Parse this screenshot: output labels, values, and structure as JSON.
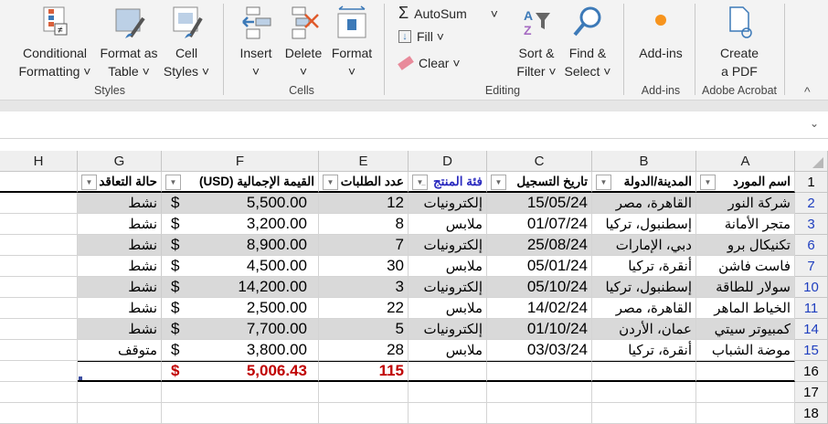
{
  "ribbon": {
    "styles": {
      "conditional": [
        "Conditional",
        "Formatting ˅"
      ],
      "format_table": [
        "Format as",
        "Table ˅"
      ],
      "cell_styles": [
        "Cell",
        "Styles ˅"
      ],
      "label": "Styles"
    },
    "cells": {
      "insert": "Insert",
      "delete": "Delete",
      "format": "Format",
      "label": "Cells"
    },
    "editing": {
      "autosum": "AutoSum",
      "fill": "Fill ˅",
      "clear": "Clear ˅",
      "sort": [
        "Sort &",
        "Filter ˅"
      ],
      "find": [
        "Find &",
        "Select ˅"
      ],
      "label": "Editing"
    },
    "addins": {
      "button": "Add-ins",
      "label": "Add-ins"
    },
    "acrobat": {
      "button": [
        "Create",
        "a PDF"
      ],
      "label": "Adobe Acrobat"
    }
  },
  "sheet": {
    "columns": [
      "H",
      "G",
      "F",
      "E",
      "D",
      "C",
      "B",
      "A"
    ],
    "headers": {
      "A": "اسم المورد",
      "B": "المدينة/الدولة",
      "C": "تاريخ التسجيل",
      "D": "فئة المنتج",
      "E": "عدد الطلبات",
      "F": "(USD) القيمة الإجمالية",
      "G": "حالة التعاقد"
    },
    "rows": [
      {
        "n": "2",
        "A": "شركة النور",
        "B": "القاهرة، مصر",
        "C": "15/05/24",
        "D": "إلكترونيات",
        "E": "12",
        "F": "5,500.00",
        "G": "نشط"
      },
      {
        "n": "3",
        "A": "متجر الأمانة",
        "B": "إسطنبول، تركيا",
        "C": "01/07/24",
        "D": "ملابس",
        "E": "8",
        "F": "3,200.00",
        "G": "نشط"
      },
      {
        "n": "6",
        "A": "تكنيكال برو",
        "B": "دبي، الإمارات",
        "C": "25/08/24",
        "D": "إلكترونيات",
        "E": "7",
        "F": "8,900.00",
        "G": "نشط"
      },
      {
        "n": "7",
        "A": "فاست فاشن",
        "B": "أنقرة، تركيا",
        "C": "05/01/24",
        "D": "ملابس",
        "E": "30",
        "F": "4,500.00",
        "G": "نشط"
      },
      {
        "n": "10",
        "A": "سولار للطاقة",
        "B": "إسطنبول، تركيا",
        "C": "05/10/24",
        "D": "إلكترونيات",
        "E": "3",
        "F": "14,200.00",
        "G": "نشط"
      },
      {
        "n": "11",
        "A": "الخياط الماهر",
        "B": "القاهرة، مصر",
        "C": "14/02/24",
        "D": "ملابس",
        "E": "22",
        "F": "2,500.00",
        "G": "نشط"
      },
      {
        "n": "14",
        "A": "كمبيوتر سيتي",
        "B": "عمان، الأردن",
        "C": "01/10/24",
        "D": "إلكترونيات",
        "E": "5",
        "F": "7,700.00",
        "G": "نشط"
      },
      {
        "n": "15",
        "A": "موضة الشباب",
        "B": "أنقرة، تركيا",
        "C": "03/03/24",
        "D": "ملابس",
        "E": "28",
        "F": "3,800.00",
        "G": "متوقف"
      }
    ],
    "currency": "$",
    "total": {
      "n": "16",
      "E": "115",
      "F": "5,006.43"
    },
    "empty_rows": [
      "17",
      "18"
    ],
    "colors": {
      "band": "#d9d9d9",
      "filtered_row_number": "#1f3fbf",
      "total": "#c00000",
      "filtered_header": "#2b2bbf"
    }
  }
}
